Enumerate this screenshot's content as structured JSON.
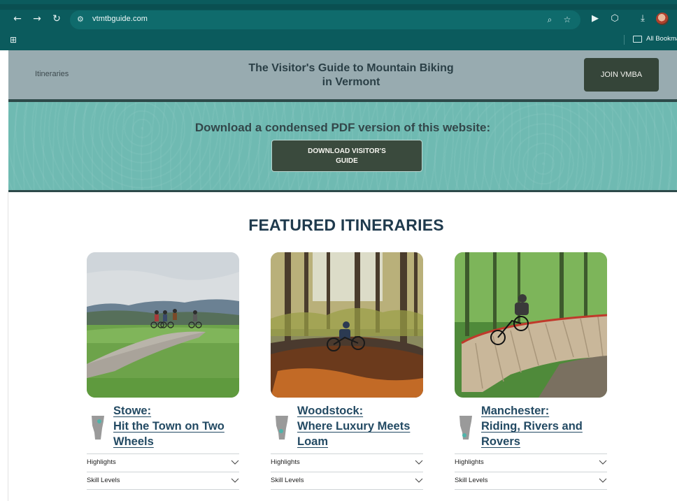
{
  "browser": {
    "url": "vtmtbguide.com",
    "bookmarks_label": "All Bookma"
  },
  "header": {
    "nav_link": "Itineraries",
    "title_line1": "The Visitor's Guide to Mountain Biking",
    "title_line2": "in Vermont",
    "join_label": "JOIN VMBA"
  },
  "banner": {
    "text": "Download a condensed PDF version of this website:",
    "button_line1": "DOWNLOAD VISITOR'S",
    "button_line2": "GUIDE"
  },
  "featured": {
    "heading": "FEATURED ITINERARIES",
    "cards": [
      {
        "title_lines": [
          "Stowe:",
          "Hit the Town on Two",
          "Wheels"
        ],
        "accordions": [
          "Highlights",
          "Skill Levels"
        ]
      },
      {
        "title_lines": [
          "Woodstock:",
          "Where Luxury Meets",
          "Loam"
        ],
        "accordions": [
          "Highlights",
          "Skill Levels"
        ]
      },
      {
        "title_lines": [
          "Manchester:",
          "Riding, Rivers and",
          "Rovers"
        ],
        "accordions": [
          "Highlights",
          "Skill Levels"
        ]
      }
    ]
  },
  "colors": {
    "chrome": "#0b5b5d",
    "header_bg": "#98abb0",
    "banner_bg": "#6fbab2",
    "button_dark": "#354539",
    "title_blue": "#234a63",
    "map_accent": "#4fb3aa"
  },
  "icons": [
    "back-arrow-icon",
    "forward-arrow-icon",
    "reload-icon",
    "site-settings-icon",
    "zoom-icon",
    "star-icon",
    "media-icon",
    "extensions-icon",
    "download-icon",
    "apps-icon",
    "folder-icon",
    "vermont-map-icon",
    "chevron-down-icon"
  ]
}
